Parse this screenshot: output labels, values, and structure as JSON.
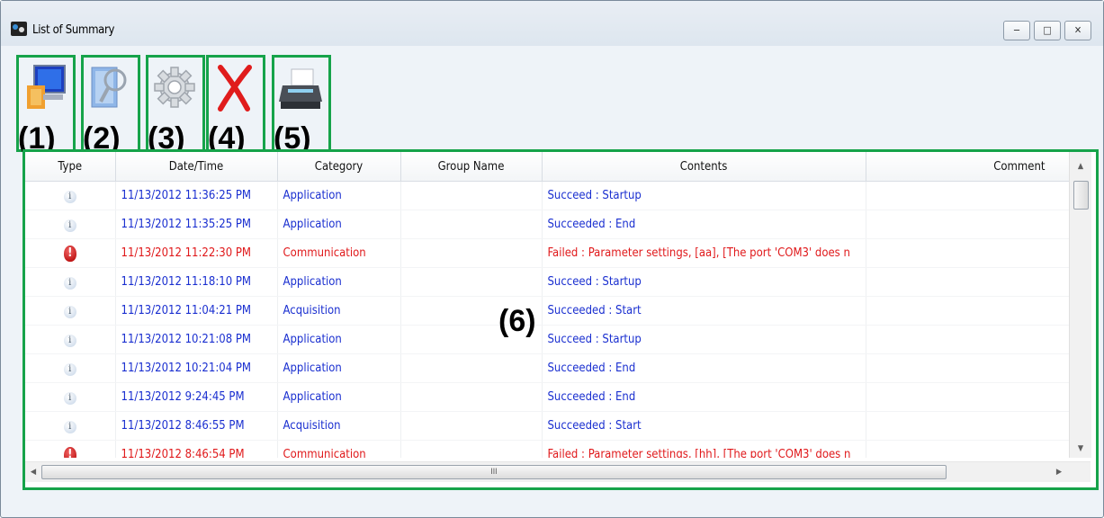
{
  "window": {
    "title": "List of Summary",
    "controls": {
      "minimize": "−",
      "maximize": "□",
      "close": "✕"
    }
  },
  "toolbar": {
    "buttons": [
      {
        "number": "(1)",
        "icon": "computer-export-icon"
      },
      {
        "number": "(2)",
        "icon": "search-document-icon"
      },
      {
        "number": "(3)",
        "icon": "gear-icon"
      },
      {
        "number": "(4)",
        "icon": "delete-x-icon"
      },
      {
        "number": "(5)",
        "icon": "printer-icon"
      }
    ]
  },
  "grid_label": "(6)",
  "table": {
    "columns": [
      "Type",
      "Date/Time",
      "Category",
      "Group Name",
      "Contents",
      "Comment"
    ],
    "rows": [
      {
        "type": "info",
        "datetime": "11/13/2012 11:36:25 PM",
        "category": "Application",
        "group": "",
        "contents": "Succeed : Startup",
        "comment": ""
      },
      {
        "type": "info",
        "datetime": "11/13/2012 11:35:25 PM",
        "category": "Application",
        "group": "",
        "contents": "Succeeded : End",
        "comment": ""
      },
      {
        "type": "error",
        "datetime": "11/13/2012 11:22:30 PM",
        "category": "Communication",
        "group": "",
        "contents": "Failed : Parameter settings, [aa], [The port 'COM3' does n",
        "comment": ""
      },
      {
        "type": "info",
        "datetime": "11/13/2012 11:18:10 PM",
        "category": "Application",
        "group": "",
        "contents": "Succeed : Startup",
        "comment": ""
      },
      {
        "type": "info",
        "datetime": "11/13/2012 11:04:21 PM",
        "category": "Acquisition",
        "group": "",
        "contents": "Succeeded : Start",
        "comment": ""
      },
      {
        "type": "info",
        "datetime": "11/13/2012 10:21:08 PM",
        "category": "Application",
        "group": "",
        "contents": "Succeed : Startup",
        "comment": ""
      },
      {
        "type": "info",
        "datetime": "11/13/2012 10:21:04 PM",
        "category": "Application",
        "group": "",
        "contents": "Succeeded : End",
        "comment": ""
      },
      {
        "type": "info",
        "datetime": "11/13/2012 9:24:45 PM",
        "category": "Application",
        "group": "",
        "contents": "Succeeded : End",
        "comment": ""
      },
      {
        "type": "info",
        "datetime": "11/13/2012 8:46:55 PM",
        "category": "Acquisition",
        "group": "",
        "contents": "Succeeded : Start",
        "comment": ""
      },
      {
        "type": "error",
        "datetime": "11/13/2012 8:46:54 PM",
        "category": "Communication",
        "group": "",
        "contents": "Failed : Parameter settings, [hh], [The port 'COM3' does n",
        "comment": ""
      }
    ]
  },
  "colors": {
    "info_text": "#1a2fd0",
    "error_text": "#e0191b",
    "highlight_frame": "#16a34a"
  },
  "scrollbar": {
    "hthumb_grip": "III",
    "up": "▲",
    "down": "▼",
    "left": "◀",
    "right": "▶"
  }
}
